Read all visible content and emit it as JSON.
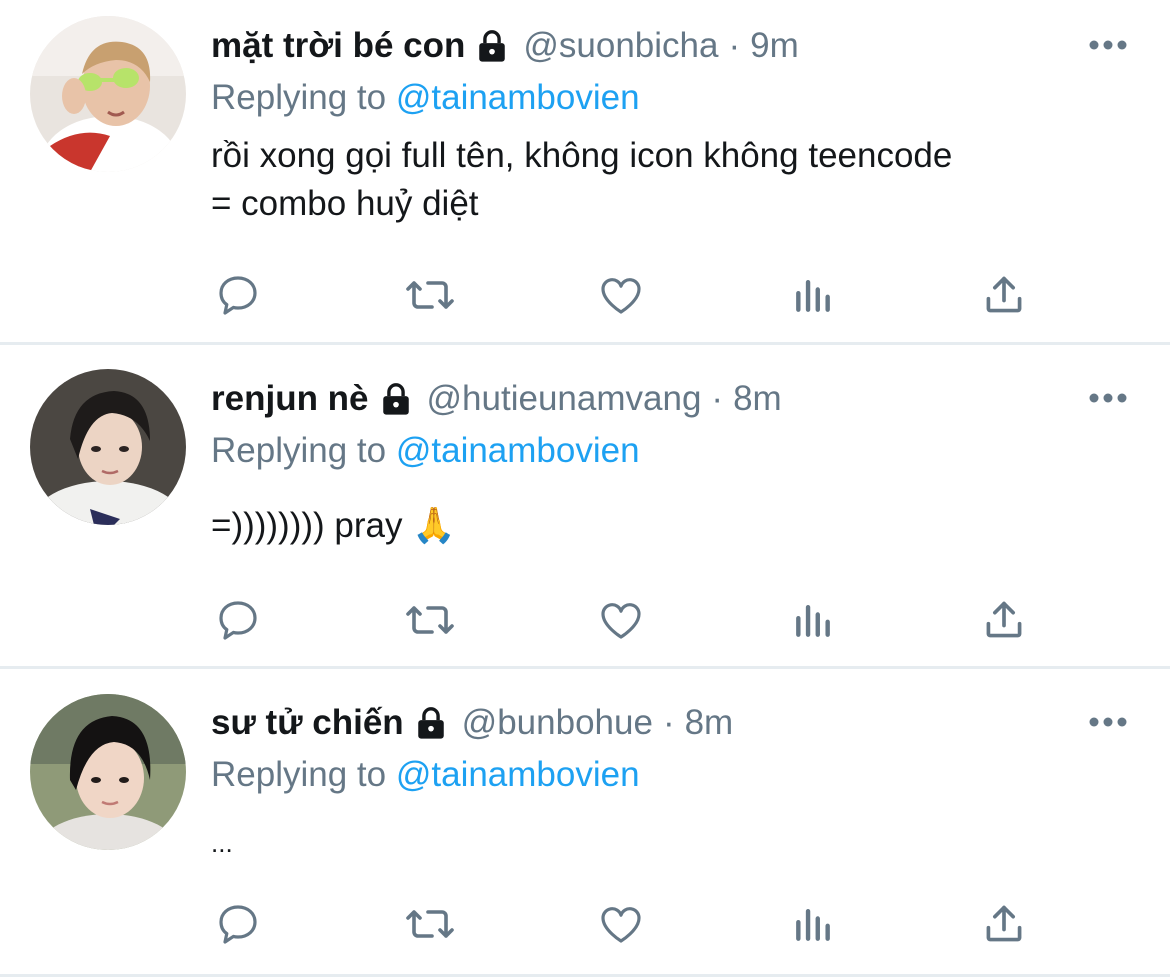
{
  "tweets": [
    {
      "display_name": "mặt trời bé con",
      "handle": "@suonbicha",
      "separator": "·",
      "time": "9m",
      "replying_prefix": "Replying to",
      "replying_to": "@tainambovien",
      "text": "rồi xong gọi full tên, không icon không teencode\n= combo huỷ diệt",
      "protected_icon": "lock-icon",
      "more_icon": "more-dots-icon"
    },
    {
      "display_name": "renjun nè",
      "handle": "@hutieunamvang",
      "separator": "·",
      "time": "8m",
      "replying_prefix": "Replying to",
      "replying_to": "@tainambovien",
      "text": "=)))))))) pray 🙏",
      "protected_icon": "lock-icon",
      "more_icon": "more-dots-icon"
    },
    {
      "display_name": "sư tử chiến",
      "handle": "@bunbohue",
      "separator": "·",
      "time": "8m",
      "replying_prefix": "Replying to",
      "replying_to": "@tainambovien",
      "text": "...",
      "protected_icon": "lock-icon",
      "more_icon": "more-dots-icon"
    }
  ],
  "action_icons": [
    "reply-icon",
    "retweet-icon",
    "like-icon",
    "analytics-icon",
    "share-icon"
  ],
  "colors": {
    "text": "#14171a",
    "secondary": "#657786",
    "link": "#1da1f2",
    "divider": "#e6ecf0",
    "icon": "#657786"
  }
}
